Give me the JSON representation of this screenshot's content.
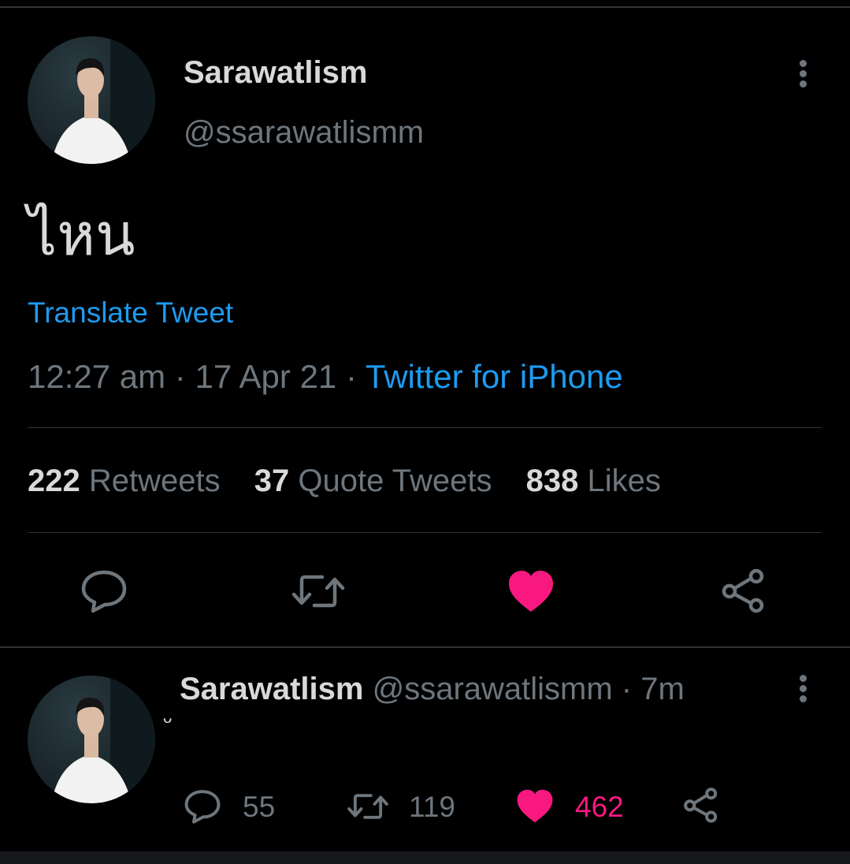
{
  "tweet": {
    "display_name": "Sarawatlism",
    "handle": "@ssarawatlismm",
    "text": "ไหน",
    "translate_label": "Translate Tweet",
    "time": "12:27 am",
    "date": "17 Apr 21",
    "source": "Twitter for iPhone",
    "stats": {
      "retweets": "222",
      "retweets_label": "Retweets",
      "quote_tweets": "37",
      "quote_tweets_label": "Quote Tweets",
      "likes": "838",
      "likes_label": "Likes"
    }
  },
  "reply": {
    "display_name": "Sarawatlism",
    "handle": "@ssarawatlismm",
    "age": "7m",
    "text": "ᵕ",
    "replies": "55",
    "retweets": "119",
    "likes": "462"
  },
  "separator": "·",
  "colors": {
    "background": "#000000",
    "text": "#d9d9d9",
    "muted": "#6e767d",
    "link": "#1d9bf0",
    "like": "#f91880"
  },
  "icons": [
    "avatar",
    "more-icon",
    "reply-icon",
    "retweet-icon",
    "heart-icon",
    "share-icon"
  ]
}
